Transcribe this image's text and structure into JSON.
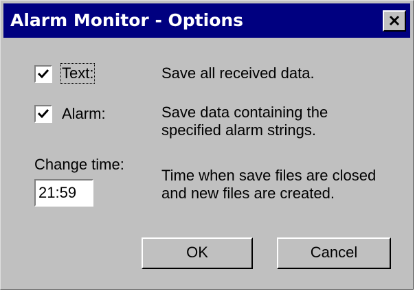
{
  "window": {
    "title": "Alarm Monitor - Options",
    "close_icon": "close-icon"
  },
  "options": {
    "text": {
      "label": "Text:",
      "checked": true,
      "description": "Save all received data."
    },
    "alarm": {
      "label": "Alarm:",
      "checked": true,
      "description_line1": "Save data containing the",
      "description_line2": "specified alarm strings."
    }
  },
  "change_time": {
    "label": "Change time:",
    "value": "21:59",
    "description_line1": "Time when save files are closed",
    "description_line2": "and new files are created."
  },
  "buttons": {
    "ok": "OK",
    "cancel": "Cancel"
  },
  "colors": {
    "titlebar": "#000080",
    "face": "#c0c0c0"
  }
}
